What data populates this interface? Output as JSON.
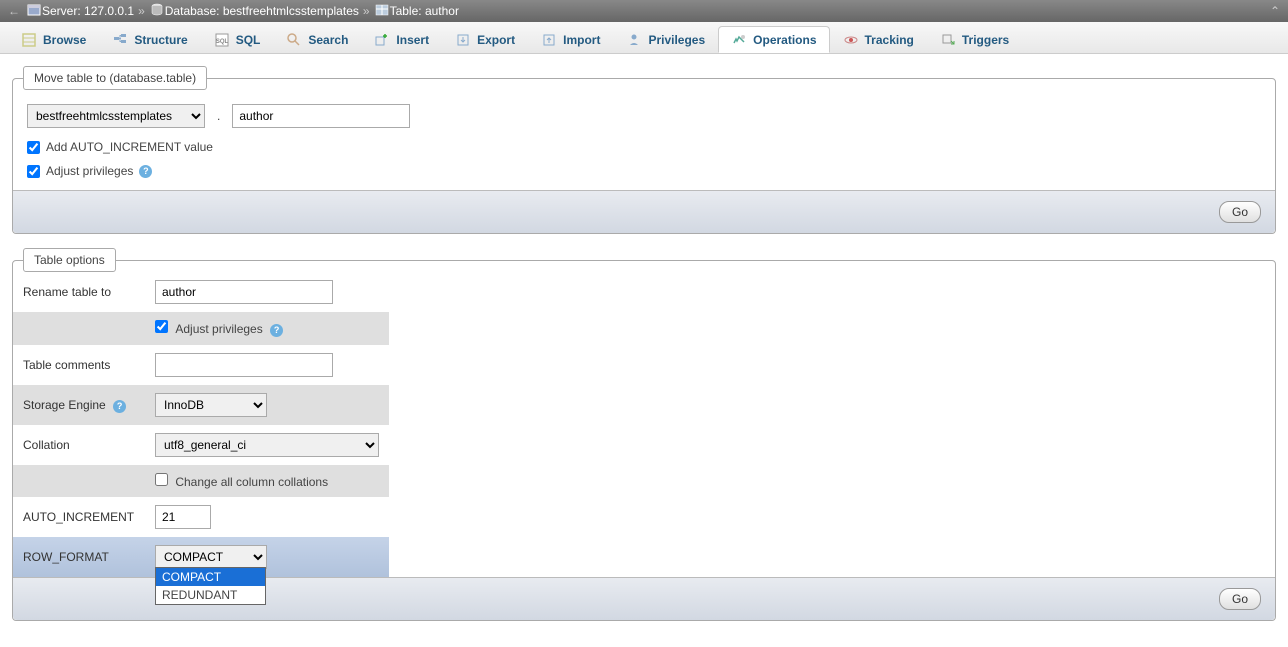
{
  "breadcrumb": {
    "server_label": "Server:",
    "server": "127.0.0.1",
    "database_label": "Database:",
    "database": "bestfreehtmlcsstemplates",
    "table_label": "Table:",
    "table": "author"
  },
  "tabs": [
    {
      "id": "browse",
      "label": "Browse"
    },
    {
      "id": "structure",
      "label": "Structure"
    },
    {
      "id": "sql",
      "label": "SQL"
    },
    {
      "id": "search",
      "label": "Search"
    },
    {
      "id": "insert",
      "label": "Insert"
    },
    {
      "id": "export",
      "label": "Export"
    },
    {
      "id": "import",
      "label": "Import"
    },
    {
      "id": "privileges",
      "label": "Privileges"
    },
    {
      "id": "operations",
      "label": "Operations",
      "active": true
    },
    {
      "id": "tracking",
      "label": "Tracking"
    },
    {
      "id": "triggers",
      "label": "Triggers"
    }
  ],
  "move_table": {
    "legend": "Move table to (database.table)",
    "database_selected": "bestfreehtmlcsstemplates",
    "table_value": "author",
    "auto_increment_label": "Add AUTO_INCREMENT value",
    "auto_increment_checked": true,
    "adjust_privileges_label": "Adjust privileges",
    "adjust_privileges_checked": true,
    "go_label": "Go"
  },
  "table_options": {
    "legend": "Table options",
    "rename_label": "Rename table to",
    "rename_value": "author",
    "adjust_privileges_label": "Adjust privileges",
    "adjust_privileges_checked": true,
    "comments_label": "Table comments",
    "comments_value": "",
    "engine_label": "Storage Engine",
    "engine_value": "InnoDB",
    "collation_label": "Collation",
    "collation_value": "utf8_general_ci",
    "change_collations_label": "Change all column collations",
    "change_collations_checked": false,
    "auto_increment_label": "AUTO_INCREMENT",
    "auto_increment_value": "21",
    "row_format_label": "ROW_FORMAT",
    "row_format_value": "COMPACT",
    "row_format_options": [
      "COMPACT",
      "REDUNDANT"
    ],
    "go_label": "Go"
  }
}
